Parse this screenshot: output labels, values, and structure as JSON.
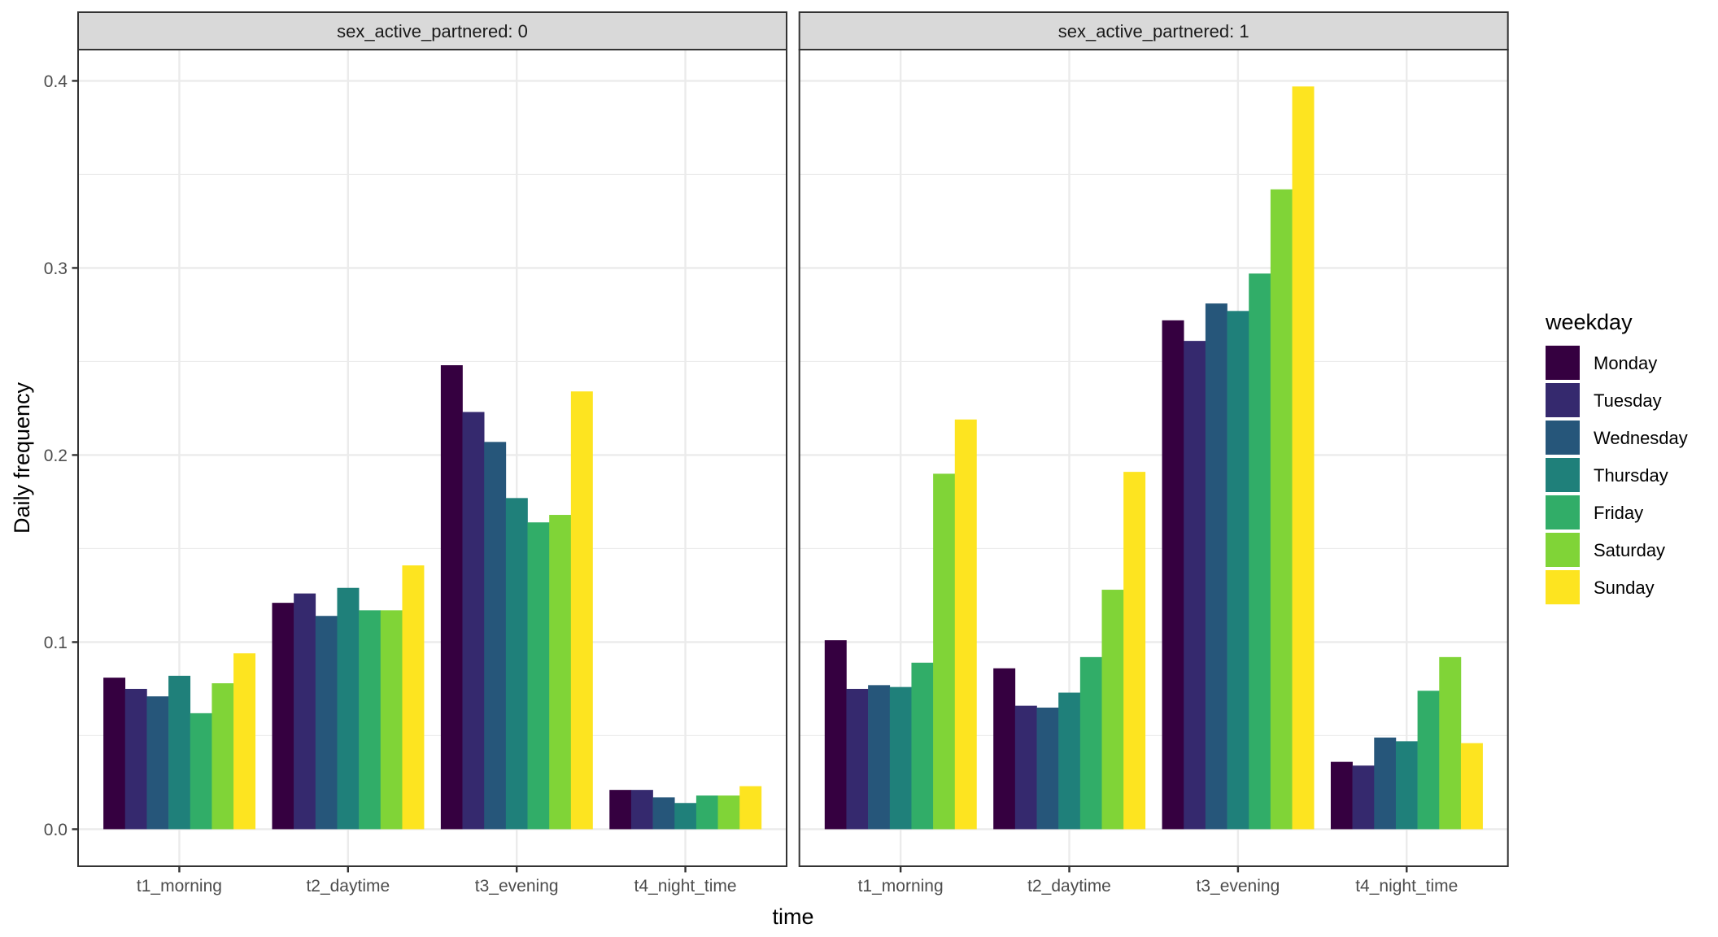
{
  "chart_data": {
    "type": "bar",
    "subtype": "grouped-faceted",
    "title": "",
    "xlabel": "time",
    "ylabel": "Daily frequency",
    "ylim": [
      -0.0198,
      0.4167
    ],
    "y_ticks": [
      0.0,
      0.1,
      0.2,
      0.3,
      0.4
    ],
    "y_tick_labels": [
      "0.0",
      "0.1",
      "0.2",
      "0.3",
      "0.4"
    ],
    "y_minor_ticks": [
      0.05,
      0.15,
      0.25,
      0.35
    ],
    "grid": true,
    "categories": [
      "t1_morning",
      "t2_daytime",
      "t3_evening",
      "t4_night_time"
    ],
    "legend": {
      "title": "weekday",
      "placement": "right",
      "entries": [
        {
          "label": "Monday",
          "color": "#350040"
        },
        {
          "label": "Tuesday",
          "color": "#35296e"
        },
        {
          "label": "Wednesday",
          "color": "#26567a"
        },
        {
          "label": "Thursday",
          "color": "#1f807a"
        },
        {
          "label": "Friday",
          "color": "#31ad68"
        },
        {
          "label": "Saturday",
          "color": "#80d437"
        },
        {
          "label": "Sunday",
          "color": "#fde420"
        }
      ]
    },
    "facets": [
      {
        "strip_label": "sex_active_partnered: 0",
        "series": [
          {
            "name": "Monday",
            "values": [
              0.081,
              0.121,
              0.248,
              0.021
            ]
          },
          {
            "name": "Tuesday",
            "values": [
              0.075,
              0.126,
              0.223,
              0.021
            ]
          },
          {
            "name": "Wednesday",
            "values": [
              0.071,
              0.114,
              0.207,
              0.017
            ]
          },
          {
            "name": "Thursday",
            "values": [
              0.082,
              0.129,
              0.177,
              0.014
            ]
          },
          {
            "name": "Friday",
            "values": [
              0.062,
              0.117,
              0.164,
              0.018
            ]
          },
          {
            "name": "Saturday",
            "values": [
              0.078,
              0.117,
              0.168,
              0.018
            ]
          },
          {
            "name": "Sunday",
            "values": [
              0.094,
              0.141,
              0.234,
              0.023
            ]
          }
        ]
      },
      {
        "strip_label": "sex_active_partnered: 1",
        "series": [
          {
            "name": "Monday",
            "values": [
              0.101,
              0.086,
              0.272,
              0.036
            ]
          },
          {
            "name": "Tuesday",
            "values": [
              0.075,
              0.066,
              0.261,
              0.034
            ]
          },
          {
            "name": "Wednesday",
            "values": [
              0.077,
              0.065,
              0.281,
              0.049
            ]
          },
          {
            "name": "Thursday",
            "values": [
              0.076,
              0.073,
              0.277,
              0.047
            ]
          },
          {
            "name": "Friday",
            "values": [
              0.089,
              0.092,
              0.297,
              0.074
            ]
          },
          {
            "name": "Saturday",
            "values": [
              0.19,
              0.128,
              0.342,
              0.092
            ]
          },
          {
            "name": "Sunday",
            "values": [
              0.219,
              0.191,
              0.397,
              0.046
            ]
          }
        ]
      }
    ]
  }
}
